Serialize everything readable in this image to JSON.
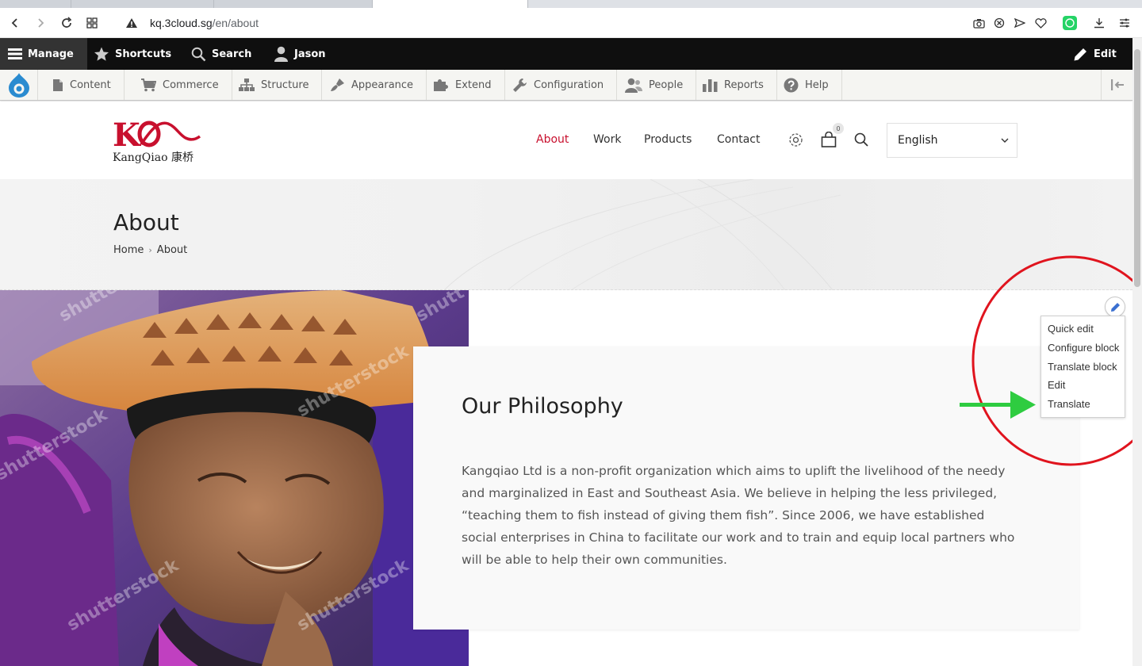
{
  "browser": {
    "url_host": "kq.3cloud.sg",
    "url_path": "/en/about"
  },
  "toolbar": {
    "manage": "Manage",
    "shortcuts": "Shortcuts",
    "search": "Search",
    "user": "Jason",
    "edit": "Edit"
  },
  "admin_menu": [
    {
      "label": "Content",
      "icon": "document-icon"
    },
    {
      "label": "Commerce",
      "icon": "cart-icon"
    },
    {
      "label": "Structure",
      "icon": "hierarchy-icon"
    },
    {
      "label": "Appearance",
      "icon": "paintbrush-icon"
    },
    {
      "label": "Extend",
      "icon": "puzzle-icon"
    },
    {
      "label": "Configuration",
      "icon": "wrench-icon"
    },
    {
      "label": "People",
      "icon": "person-icon"
    },
    {
      "label": "Reports",
      "icon": "bar-chart-icon"
    },
    {
      "label": "Help",
      "icon": "help-icon"
    }
  ],
  "site": {
    "logo_text": "KangQiao 康桥",
    "brand_color": "#c8102e",
    "menu": [
      "About",
      "Work",
      "Products",
      "Contact"
    ],
    "cart_count": "0",
    "language": "English"
  },
  "banner": {
    "title": "About",
    "breadcrumb_home": "Home",
    "breadcrumb_sep": "›",
    "breadcrumb_current": "About"
  },
  "card": {
    "title": "Our Philosophy",
    "body": "Kangqiao Ltd is a non-profit organization which aims to uplift the livelihood of the needy and marginalized in East and Southeast Asia. We believe in helping the less privileged, “teaching them to fish instead of giving them fish”. Since 2006, we have established social enterprises in China to facilitate our work and to train and equip local partners who will be able to help their own communities."
  },
  "contextual_menu": [
    "Quick edit",
    "Configure block",
    "Translate block",
    "Edit",
    "Translate"
  ],
  "annotation": {
    "circle_color": "#e0141e",
    "arrow_color": "#2ecc40"
  }
}
